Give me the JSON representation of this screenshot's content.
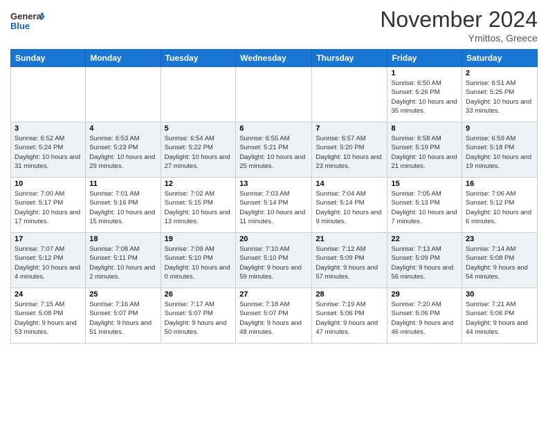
{
  "header": {
    "logo_line1": "General",
    "logo_line2": "Blue",
    "month_year": "November 2024",
    "location": "Ymittos, Greece"
  },
  "days_of_week": [
    "Sunday",
    "Monday",
    "Tuesday",
    "Wednesday",
    "Thursday",
    "Friday",
    "Saturday"
  ],
  "weeks": [
    [
      {
        "day": "",
        "sunrise": "",
        "sunset": "",
        "daylight": ""
      },
      {
        "day": "",
        "sunrise": "",
        "sunset": "",
        "daylight": ""
      },
      {
        "day": "",
        "sunrise": "",
        "sunset": "",
        "daylight": ""
      },
      {
        "day": "",
        "sunrise": "",
        "sunset": "",
        "daylight": ""
      },
      {
        "day": "",
        "sunrise": "",
        "sunset": "",
        "daylight": ""
      },
      {
        "day": "1",
        "sunrise": "Sunrise: 6:50 AM",
        "sunset": "Sunset: 5:26 PM",
        "daylight": "Daylight: 10 hours and 35 minutes."
      },
      {
        "day": "2",
        "sunrise": "Sunrise: 6:51 AM",
        "sunset": "Sunset: 5:25 PM",
        "daylight": "Daylight: 10 hours and 33 minutes."
      }
    ],
    [
      {
        "day": "3",
        "sunrise": "Sunrise: 6:52 AM",
        "sunset": "Sunset: 5:24 PM",
        "daylight": "Daylight: 10 hours and 31 minutes."
      },
      {
        "day": "4",
        "sunrise": "Sunrise: 6:53 AM",
        "sunset": "Sunset: 5:23 PM",
        "daylight": "Daylight: 10 hours and 29 minutes."
      },
      {
        "day": "5",
        "sunrise": "Sunrise: 6:54 AM",
        "sunset": "Sunset: 5:22 PM",
        "daylight": "Daylight: 10 hours and 27 minutes."
      },
      {
        "day": "6",
        "sunrise": "Sunrise: 6:55 AM",
        "sunset": "Sunset: 5:21 PM",
        "daylight": "Daylight: 10 hours and 25 minutes."
      },
      {
        "day": "7",
        "sunrise": "Sunrise: 6:57 AM",
        "sunset": "Sunset: 5:20 PM",
        "daylight": "Daylight: 10 hours and 23 minutes."
      },
      {
        "day": "8",
        "sunrise": "Sunrise: 6:58 AM",
        "sunset": "Sunset: 5:19 PM",
        "daylight": "Daylight: 10 hours and 21 minutes."
      },
      {
        "day": "9",
        "sunrise": "Sunrise: 6:59 AM",
        "sunset": "Sunset: 5:18 PM",
        "daylight": "Daylight: 10 hours and 19 minutes."
      }
    ],
    [
      {
        "day": "10",
        "sunrise": "Sunrise: 7:00 AM",
        "sunset": "Sunset: 5:17 PM",
        "daylight": "Daylight: 10 hours and 17 minutes."
      },
      {
        "day": "11",
        "sunrise": "Sunrise: 7:01 AM",
        "sunset": "Sunset: 5:16 PM",
        "daylight": "Daylight: 10 hours and 15 minutes."
      },
      {
        "day": "12",
        "sunrise": "Sunrise: 7:02 AM",
        "sunset": "Sunset: 5:15 PM",
        "daylight": "Daylight: 10 hours and 13 minutes."
      },
      {
        "day": "13",
        "sunrise": "Sunrise: 7:03 AM",
        "sunset": "Sunset: 5:14 PM",
        "daylight": "Daylight: 10 hours and 11 minutes."
      },
      {
        "day": "14",
        "sunrise": "Sunrise: 7:04 AM",
        "sunset": "Sunset: 5:14 PM",
        "daylight": "Daylight: 10 hours and 9 minutes."
      },
      {
        "day": "15",
        "sunrise": "Sunrise: 7:05 AM",
        "sunset": "Sunset: 5:13 PM",
        "daylight": "Daylight: 10 hours and 7 minutes."
      },
      {
        "day": "16",
        "sunrise": "Sunrise: 7:06 AM",
        "sunset": "Sunset: 5:12 PM",
        "daylight": "Daylight: 10 hours and 6 minutes."
      }
    ],
    [
      {
        "day": "17",
        "sunrise": "Sunrise: 7:07 AM",
        "sunset": "Sunset: 5:12 PM",
        "daylight": "Daylight: 10 hours and 4 minutes."
      },
      {
        "day": "18",
        "sunrise": "Sunrise: 7:08 AM",
        "sunset": "Sunset: 5:11 PM",
        "daylight": "Daylight: 10 hours and 2 minutes."
      },
      {
        "day": "19",
        "sunrise": "Sunrise: 7:09 AM",
        "sunset": "Sunset: 5:10 PM",
        "daylight": "Daylight: 10 hours and 0 minutes."
      },
      {
        "day": "20",
        "sunrise": "Sunrise: 7:10 AM",
        "sunset": "Sunset: 5:10 PM",
        "daylight": "Daylight: 9 hours and 59 minutes."
      },
      {
        "day": "21",
        "sunrise": "Sunrise: 7:12 AM",
        "sunset": "Sunset: 5:09 PM",
        "daylight": "Daylight: 9 hours and 57 minutes."
      },
      {
        "day": "22",
        "sunrise": "Sunrise: 7:13 AM",
        "sunset": "Sunset: 5:09 PM",
        "daylight": "Daylight: 9 hours and 56 minutes."
      },
      {
        "day": "23",
        "sunrise": "Sunrise: 7:14 AM",
        "sunset": "Sunset: 5:08 PM",
        "daylight": "Daylight: 9 hours and 54 minutes."
      }
    ],
    [
      {
        "day": "24",
        "sunrise": "Sunrise: 7:15 AM",
        "sunset": "Sunset: 5:08 PM",
        "daylight": "Daylight: 9 hours and 53 minutes."
      },
      {
        "day": "25",
        "sunrise": "Sunrise: 7:16 AM",
        "sunset": "Sunset: 5:07 PM",
        "daylight": "Daylight: 9 hours and 51 minutes."
      },
      {
        "day": "26",
        "sunrise": "Sunrise: 7:17 AM",
        "sunset": "Sunset: 5:07 PM",
        "daylight": "Daylight: 9 hours and 50 minutes."
      },
      {
        "day": "27",
        "sunrise": "Sunrise: 7:18 AM",
        "sunset": "Sunset: 5:07 PM",
        "daylight": "Daylight: 9 hours and 48 minutes."
      },
      {
        "day": "28",
        "sunrise": "Sunrise: 7:19 AM",
        "sunset": "Sunset: 5:06 PM",
        "daylight": "Daylight: 9 hours and 47 minutes."
      },
      {
        "day": "29",
        "sunrise": "Sunrise: 7:20 AM",
        "sunset": "Sunset: 5:06 PM",
        "daylight": "Daylight: 9 hours and 46 minutes."
      },
      {
        "day": "30",
        "sunrise": "Sunrise: 7:21 AM",
        "sunset": "Sunset: 5:06 PM",
        "daylight": "Daylight: 9 hours and 44 minutes."
      }
    ]
  ]
}
